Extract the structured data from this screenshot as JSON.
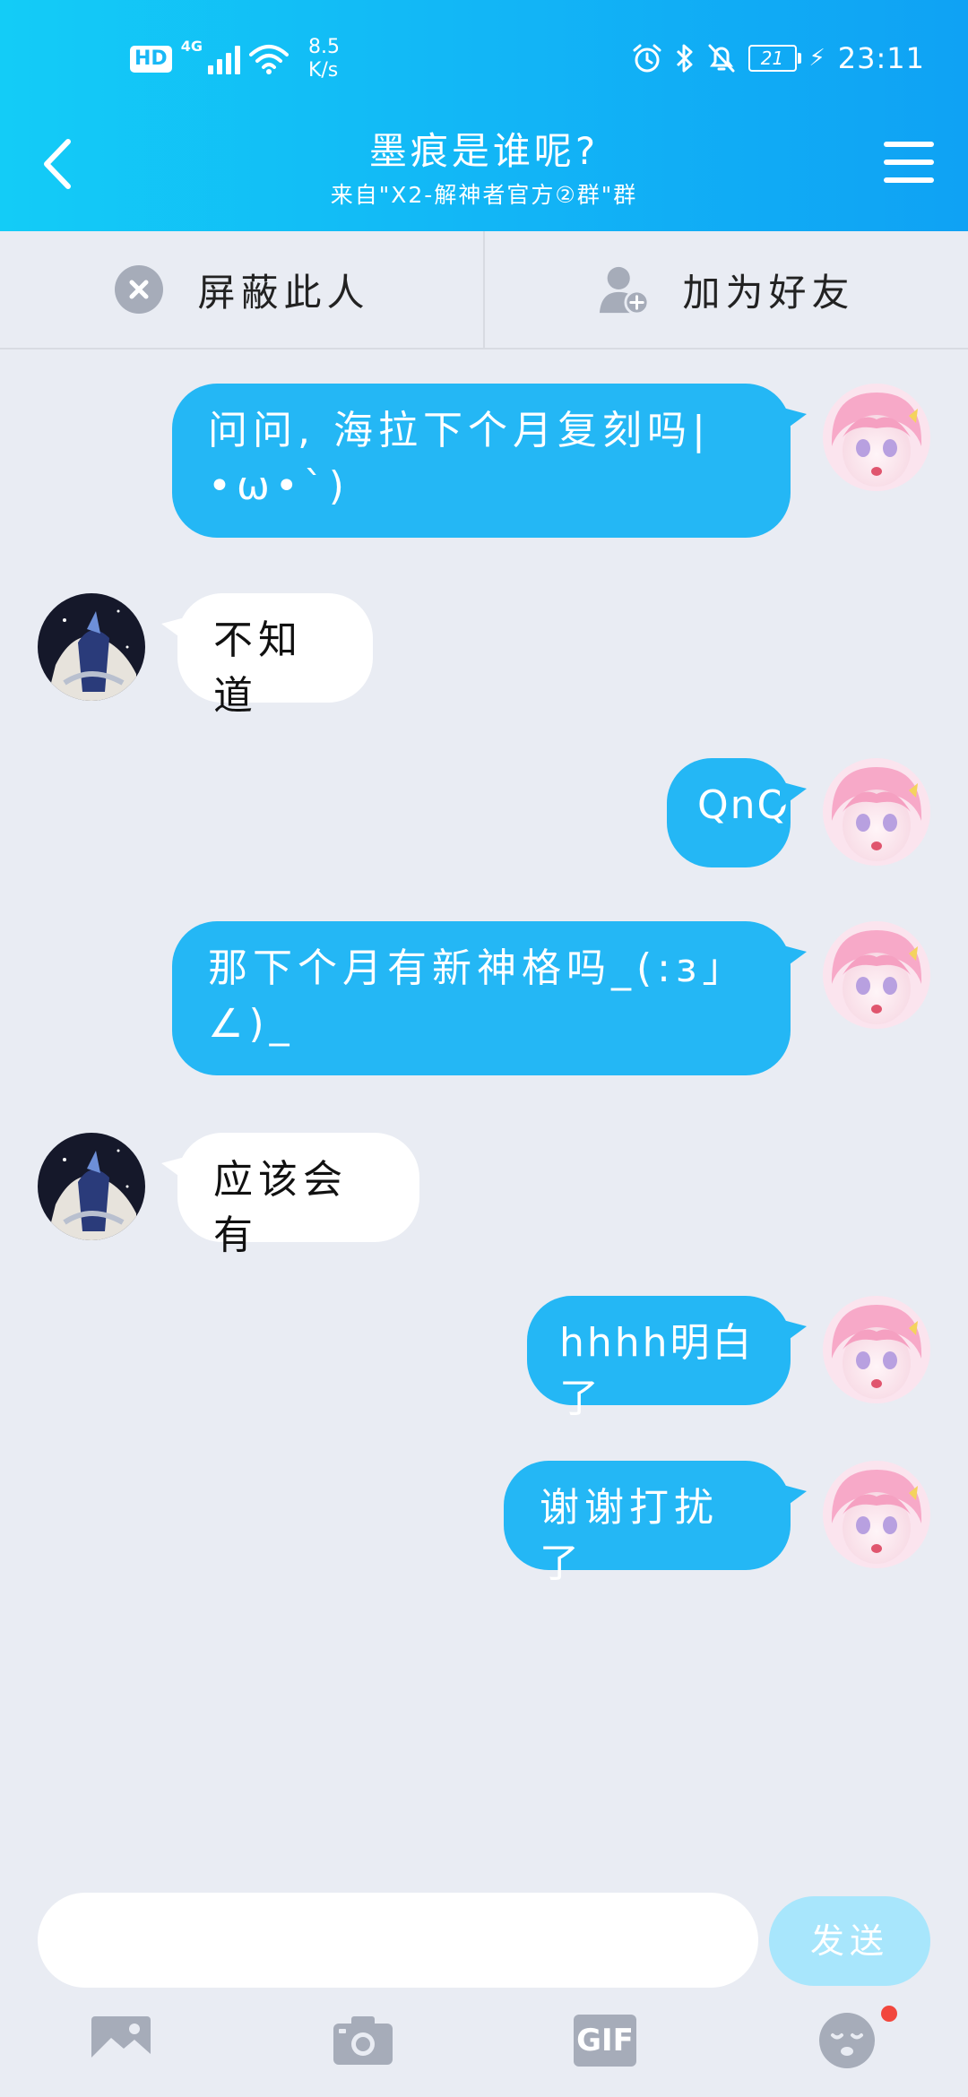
{
  "status_bar": {
    "hd": "HD",
    "network": "4G",
    "speed_value": "8.5",
    "speed_unit": "K/s",
    "battery": "21",
    "time": "23:11"
  },
  "header": {
    "title": "墨痕是谁呢?",
    "subtitle": "来自\"X2-解神者官方②群\"群"
  },
  "actions": {
    "block_label": "屏蔽此人",
    "add_friend_label": "加为好友"
  },
  "messages": [
    {
      "side": "out",
      "text": "问问, 海拉下个月复刻吗|•ω•`)"
    },
    {
      "side": "in",
      "text": "不知道"
    },
    {
      "side": "out",
      "text": "QnQ"
    },
    {
      "side": "out",
      "text": "那下个月有新神格吗_(:з」∠)_"
    },
    {
      "side": "in",
      "text": "应该会有"
    },
    {
      "side": "out",
      "text": "hhhh明白了"
    },
    {
      "side": "out",
      "text": "谢谢打扰了"
    }
  ],
  "input": {
    "value": "",
    "send_label": "发送"
  },
  "toolbar": {
    "gif_label": "GIF"
  },
  "colors": {
    "header_gradient_start": "#13ccf7",
    "header_gradient_end": "#0fa2f4",
    "outgoing_bubble": "#24b7f5",
    "incoming_bubble": "#ffffff",
    "background": "#e9ecf3",
    "send_button": "#a8e6fc",
    "badge": "#f2473d"
  }
}
